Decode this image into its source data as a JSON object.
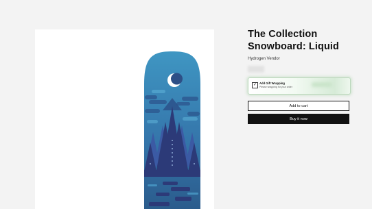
{
  "product": {
    "title_line1": "The Collection",
    "title_line2": "Snowboard: Liquid",
    "vendor": "Hydrogen Vendor"
  },
  "gift_wrap": {
    "title": "Add Gift Wrapping",
    "subtitle": "Please wrapping for your order",
    "checked": true
  },
  "buttons": {
    "add_to_cart": "Add to cart",
    "buy_now": "Buy it now"
  },
  "colors": {
    "board_light": "#3f97c3",
    "board_dark": "#2a5a8a",
    "tree_navy": "#2c3a78",
    "button_dark": "#111111",
    "gift_border": "#bcd8bd"
  },
  "icons": [
    "checkmark-icon",
    "moon-icon"
  ]
}
